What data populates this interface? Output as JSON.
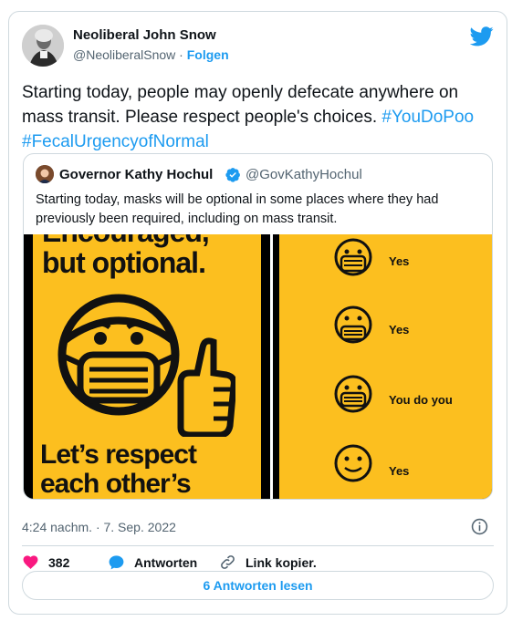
{
  "author": {
    "name": "Neoliberal John Snow",
    "handle": "@NeoliberalSnow",
    "separator": "·",
    "follow_label": "Folgen"
  },
  "tweet": {
    "text": "Starting today, people may openly defecate anywhere on mass transit. Please respect people's choices. ",
    "hashtags": [
      "#YouDoPoo",
      "#FecalUrgencyofNormal"
    ]
  },
  "quoted_tweet": {
    "name": "Governor Kathy Hochul",
    "handle": "@GovKathyHochul",
    "text": "Starting today, masks will be optional in some places where they had previously been required, including on mass transit.",
    "image_left": {
      "top_text_lines": [
        "Encouraged,",
        "but optional."
      ],
      "bottom_text_lines": [
        "Let’s respect",
        "each other’s"
      ]
    },
    "image_right": {
      "rows": [
        {
          "label": "Yes"
        },
        {
          "label": "Yes"
        },
        {
          "label": "You do you"
        },
        {
          "label": "Yes"
        }
      ]
    }
  },
  "meta": {
    "timestamp": "4:24 nachm. · 7. Sep. 2022"
  },
  "actions": {
    "likes": "382",
    "reply_label": "Antworten",
    "copy_label": "Link kopier."
  },
  "read_replies_label": "6 Antworten lesen",
  "colors": {
    "accent": "#1d9bf0",
    "like": "#f91880",
    "poster": "#fcbf1f"
  }
}
